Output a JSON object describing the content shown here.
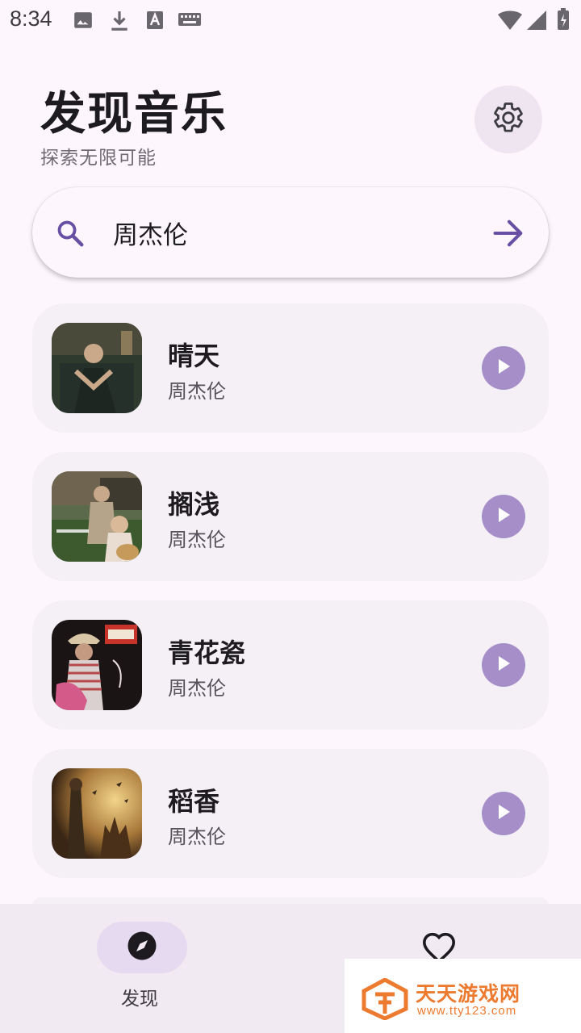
{
  "status_bar": {
    "time": "8:34",
    "left_icons": [
      "image-icon",
      "download-icon",
      "text-a-icon",
      "keyboard-icon"
    ],
    "right_icons": [
      "wifi-icon",
      "signal-icon",
      "battery-charging-icon"
    ]
  },
  "header": {
    "title": "发现音乐",
    "subtitle": "探索无限可能",
    "settings_icon": "gear-icon"
  },
  "search": {
    "value": "周杰伦",
    "icon": "search-icon",
    "submit_icon": "arrow-right-icon"
  },
  "songs": [
    {
      "title": "晴天",
      "artist": "周杰伦"
    },
    {
      "title": "搁浅",
      "artist": "周杰伦"
    },
    {
      "title": "青花瓷",
      "artist": "周杰伦"
    },
    {
      "title": "稻香",
      "artist": "周杰伦"
    }
  ],
  "bottom_nav": {
    "items": [
      {
        "label": "发现",
        "icon": "compass-icon",
        "active": true
      },
      {
        "label": "",
        "icon": "heart-icon",
        "active": false
      }
    ]
  },
  "watermark": {
    "title": "天天游戏网",
    "url": "www.tty123.com"
  },
  "colors": {
    "background": "#fdf7fd",
    "card": "#f5eff6",
    "accent": "#6750a4",
    "play_button": "#a68fc9",
    "nav_background": "#f1eaf3",
    "watermark": "#ec7a2f"
  }
}
